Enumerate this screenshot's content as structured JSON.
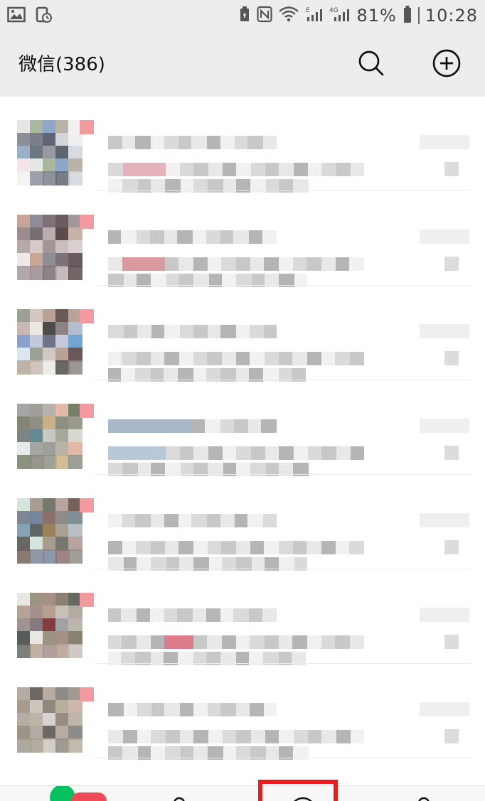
{
  "status_bar": {
    "battery": "81%",
    "time": "10:28",
    "network_label": "4G",
    "signal_label": "E"
  },
  "header": {
    "title": "微信(386)",
    "icons": [
      "search-icon",
      "add-icon"
    ]
  },
  "chats": [
    {
      "id": 1,
      "unread": true
    },
    {
      "id": 2,
      "unread": true
    },
    {
      "id": 3,
      "unread": true
    },
    {
      "id": 4,
      "unread": true
    },
    {
      "id": 5,
      "unread": true
    },
    {
      "id": 6,
      "unread": true
    },
    {
      "id": 7,
      "unread": true
    }
  ],
  "tabs": [
    "chats-tab",
    "contacts-tab",
    "discover-tab",
    "me-tab"
  ],
  "colors": {
    "header_bg": "#ededed",
    "badge": "#f04c58",
    "wechat_green": "#07c160",
    "highlight": "#ea1c22"
  }
}
